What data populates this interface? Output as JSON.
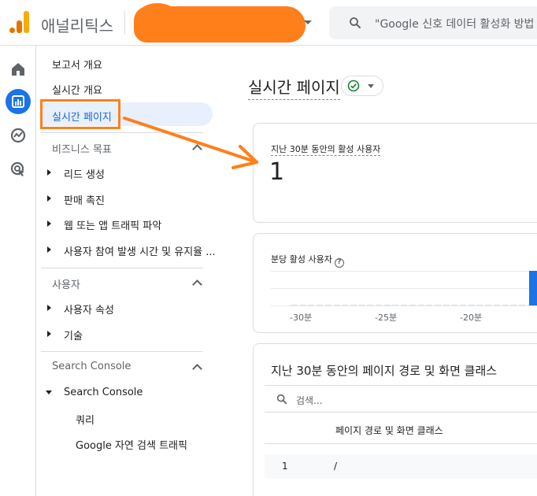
{
  "header": {
    "app_title": "애널리틱스",
    "search_placeholder": "\"Google 신호 데이터 활성화 방법"
  },
  "rail": {
    "icons": [
      "home-icon",
      "reports-icon",
      "explore-icon",
      "advertising-icon"
    ]
  },
  "nav": {
    "items": [
      {
        "label": "보고서 개요"
      },
      {
        "label": "실시간 개요"
      },
      {
        "label": "실시간 페이지",
        "active": true
      }
    ],
    "sections": {
      "business": {
        "title": "비즈니스 목표",
        "items": [
          "리드 생성",
          "판매 촉진",
          "웹 또는 앱 트래픽 파악",
          "사용자 참여 발생 시간 및 유지율 ..."
        ]
      },
      "user": {
        "title": "사용자",
        "items": [
          "사용자 속성",
          "기술"
        ]
      },
      "search_console": {
        "title": "Search Console",
        "group": "Search Console",
        "children": [
          "쿼리",
          "Google 자연 검색 트래픽"
        ]
      }
    }
  },
  "main": {
    "page_title": "실시간 페이지",
    "card_active_users": {
      "label": "지난 30분 동안의 활성 사용자",
      "value": "1"
    },
    "card_minute": {
      "label": "분당 활성 사용자",
      "ticks": [
        "-30분",
        "-25분",
        "-20분"
      ]
    },
    "card_pages": {
      "title": "지난 30분 동안의 페이지 경로 및 화면 클래스",
      "search_placeholder": "검색...",
      "column": "페이지 경로 및 화면 클래스",
      "rows": [
        {
          "index": "1",
          "path": "/"
        }
      ]
    }
  },
  "colors": {
    "accent": "#1a73e8",
    "annotation": "#ff7f1a",
    "active_bg": "#e8f0fe",
    "success": "#188038"
  },
  "chart_data": {
    "type": "bar",
    "title": "분당 활성 사용자",
    "xlabel": "",
    "ylabel": "",
    "categories": [
      "-30분",
      "-25분",
      "-20분"
    ],
    "series": [
      {
        "values": [
          0,
          0,
          0,
          0,
          0,
          0,
          0,
          0,
          0,
          0,
          0,
          0,
          0,
          0,
          0,
          0,
          0,
          0,
          0,
          0,
          0,
          0,
          0,
          0,
          0,
          0,
          0,
          0,
          0,
          1
        ]
      }
    ],
    "grid": true
  }
}
